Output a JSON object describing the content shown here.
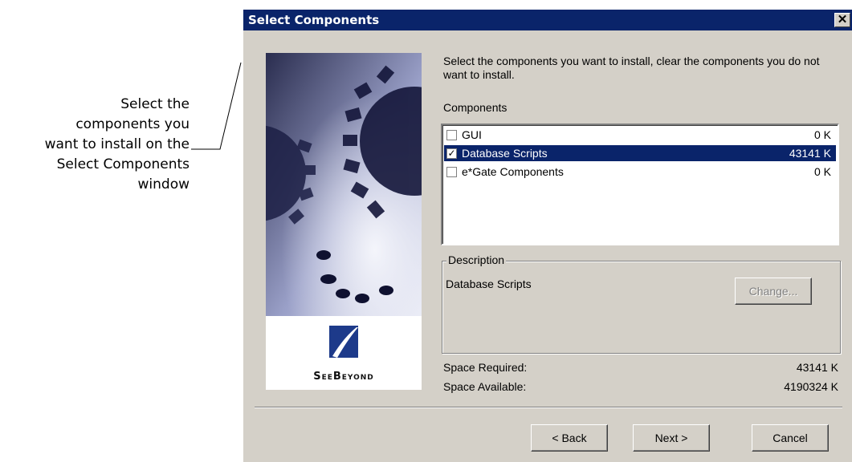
{
  "callout": {
    "lines": [
      "Select the",
      "components you",
      "want to install on the",
      "Select Components",
      "window"
    ]
  },
  "window": {
    "title": "Select Components",
    "close_glyph": "✕"
  },
  "banner": {
    "logo_text": "SeeBeyond",
    "logo_icon": "seebeyond-logo"
  },
  "instructions": "Select the components you want to install, clear the components you do not want to install.",
  "components_label": "Components",
  "components": [
    {
      "name": "GUI",
      "size": "0 K",
      "checked": false,
      "selected": false
    },
    {
      "name": "Database Scripts",
      "size": "43141 K",
      "checked": true,
      "selected": true
    },
    {
      "name": "e*Gate Components",
      "size": "0 K",
      "checked": false,
      "selected": false
    }
  ],
  "description": {
    "label": "Description",
    "text": "Database Scripts",
    "change_label": "Change..."
  },
  "space": {
    "required_label": "Space Required:",
    "required_value": "43141 K",
    "available_label": "Space Available:",
    "available_value": "4190324 K"
  },
  "buttons": {
    "back": "< Back",
    "next": "Next >",
    "cancel": "Cancel"
  },
  "colors": {
    "titlebar": "#0a246a",
    "dialog_bg": "#d4d0c8",
    "selection": "#0a246a"
  }
}
